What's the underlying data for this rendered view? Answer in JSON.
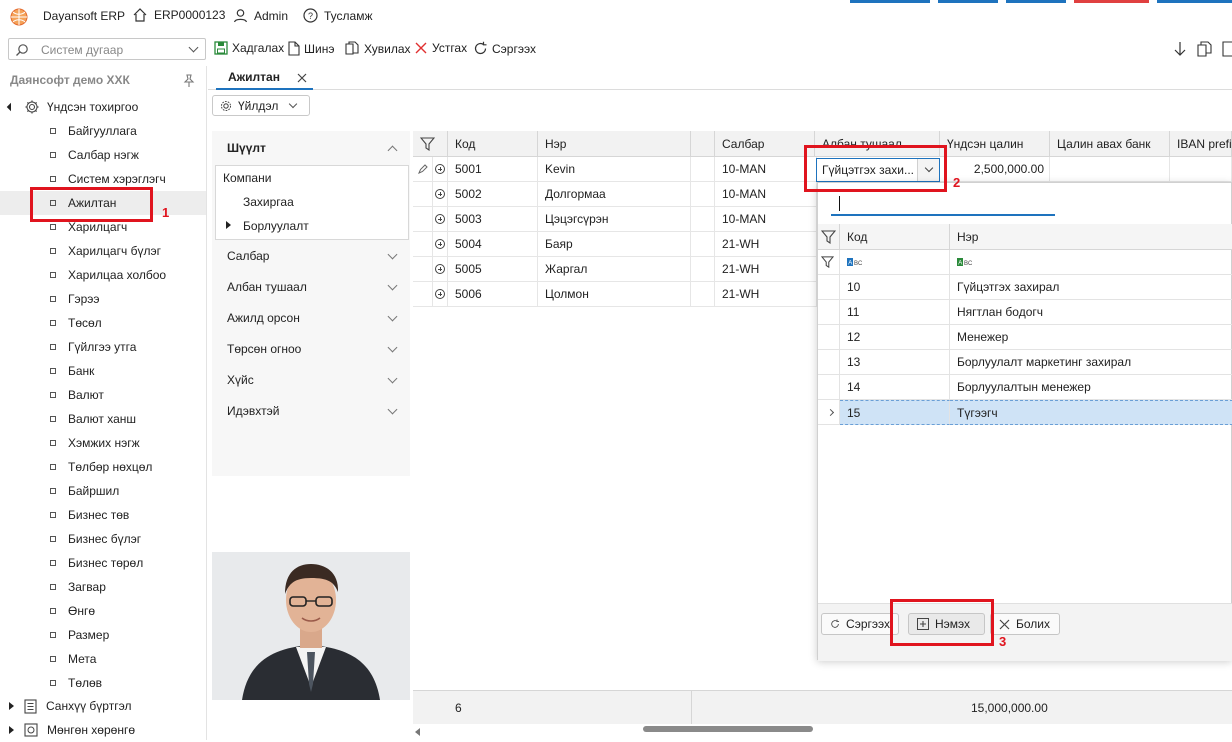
{
  "app": {
    "name": "Dayansoft ERP",
    "doc_no": "ERP0000123",
    "user": "Admin",
    "help": "Тусламж"
  },
  "toolbar": {
    "search_placeholder": "Систем дугаар",
    "save": "Хадгалах",
    "new": "Шинэ",
    "copy": "Хувилах",
    "delete": "Устгах",
    "refresh": "Сэргээх"
  },
  "sidebar": {
    "company": "Даянсофт демо ХХК",
    "root": "Үндсэн тохиргоо",
    "items": [
      "Байгууллага",
      "Салбар нэгж",
      "Систем хэрэглэгч",
      "Ажилтан",
      "Харилцагч",
      "Харилцагч бүлэг",
      "Харилцаа холбоо",
      "Гэрээ",
      "Төсөл",
      "Гүйлгээ утга",
      "Банк",
      "Валют",
      "Валют ханш",
      "Хэмжих нэгж",
      "Төлбөр нөхцөл",
      "Байршил",
      "Бизнес төв",
      "Бизнес бүлэг",
      "Бизнес төрөл",
      "Загвар",
      "Өнгө",
      "Размер",
      "Мета",
      "Төлөв"
    ],
    "bottom": [
      "Санхүү бүртгэл",
      "Мөнгөн хөрөнгө"
    ]
  },
  "tab": {
    "label": "Ажилтан"
  },
  "action": {
    "label": "Үйлдэл"
  },
  "filter": {
    "title": "Шүүлт",
    "tree": [
      "Компани",
      "Захиргаа",
      "Борлуулалт"
    ],
    "groups": [
      "Салбар",
      "Албан тушаал",
      "Ажилд орсон",
      "Төрсөн огноо",
      "Хүйс",
      "Идэвхтэй"
    ]
  },
  "grid": {
    "headers": [
      "Код",
      "Нэр",
      "Салбар",
      "Албан тушаал",
      "Үндсэн цалин",
      "Цалин авах банк",
      "IBAN prefix"
    ],
    "rows": [
      {
        "code": "5001",
        "name": "Kevin",
        "branch": "10-MAN"
      },
      {
        "code": "5002",
        "name": "Долгормаа",
        "branch": "10-MAN"
      },
      {
        "code": "5003",
        "name": "Цэцэгсүрэн",
        "branch": "10-MAN"
      },
      {
        "code": "5004",
        "name": "Баяр",
        "branch": "21-WH"
      },
      {
        "code": "5005",
        "name": "Жаргал",
        "branch": "21-WH"
      },
      {
        "code": "5006",
        "name": "Цолмон",
        "branch": "21-WH"
      }
    ],
    "edit_value": "Гүйцэтгэх захи...",
    "salary": "2,500,000.00",
    "footer_count": "6",
    "footer_sum": "15,000,000.00"
  },
  "popup": {
    "headers": [
      "Код",
      "Нэр"
    ],
    "rows": [
      {
        "code": "10",
        "name": "Гүйцэтгэх захирал"
      },
      {
        "code": "11",
        "name": "Нягтлан бодогч"
      },
      {
        "code": "12",
        "name": "Менежер"
      },
      {
        "code": "13",
        "name": "Борлуулалт маркетинг захирал"
      },
      {
        "code": "14",
        "name": "Борлуулалтын менежер"
      },
      {
        "code": "15",
        "name": "Түгээгч"
      }
    ],
    "refresh": "Сэргээх",
    "add": "Нэмэх",
    "cancel": "Болих"
  },
  "callouts": [
    "1",
    "2",
    "3"
  ]
}
